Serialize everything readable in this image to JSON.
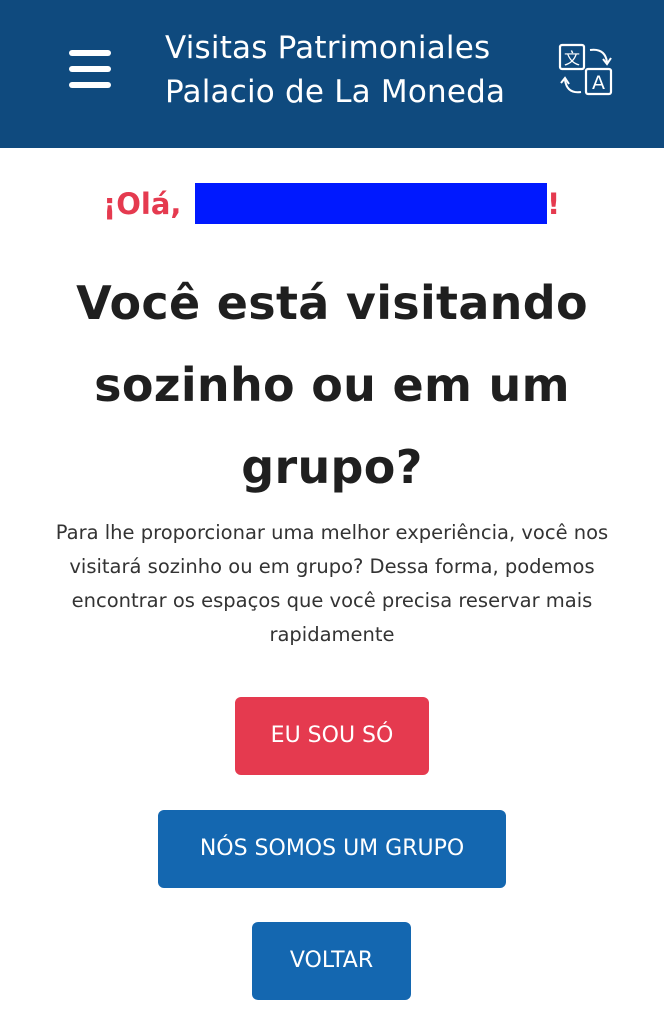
{
  "header": {
    "title_line1": "Visitas Patrimoniales",
    "title_line2": "Palacio de La Moneda",
    "menu_icon": "hamburger-menu-icon",
    "language_icon": "translate-icon"
  },
  "greeting": {
    "hello": "¡Olá,",
    "name": "",
    "exclamation": "!"
  },
  "main": {
    "question": "Você está visitando sozinho ou em um grupo?",
    "description": "Para lhe proporcionar uma melhor experiência, você nos visitará sozinho ou em grupo? Dessa forma, podemos encontrar os espaços que você precisa reservar mais rapidamente"
  },
  "actions": {
    "alone_label": "EU SOU SÓ",
    "group_label": "NÓS SOMOS UM GRUPO",
    "back_label": "VOLTAR"
  },
  "colors": {
    "header_bg": "#0f4a7e",
    "accent_red": "#e53a4f",
    "primary_blue": "#1467b0",
    "redaction": "#0019ff"
  }
}
